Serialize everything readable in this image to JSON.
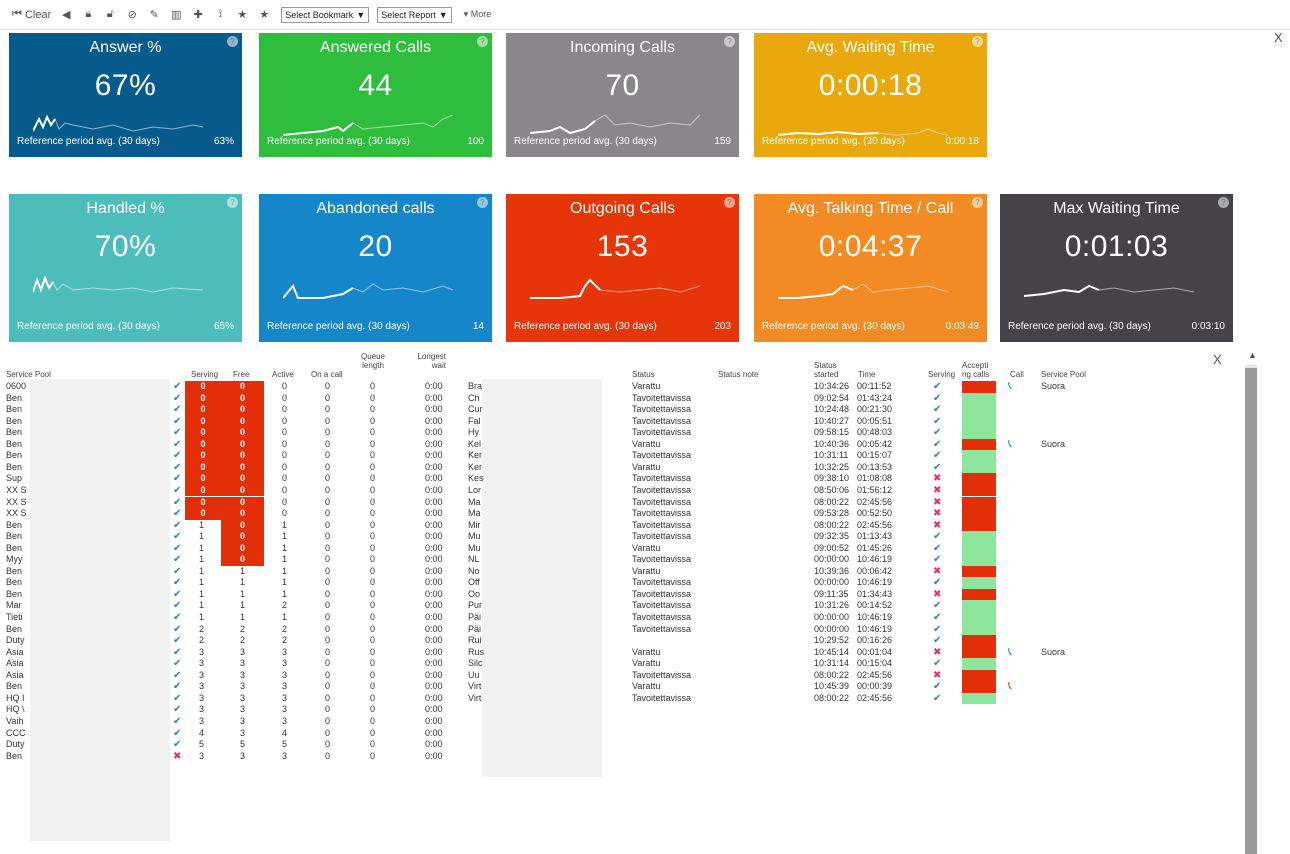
{
  "toolbar": {
    "clear_label": "Clear",
    "bookmark_select": "Select Bookmark",
    "report_select": "Select Report",
    "more_label": "More"
  },
  "close_label": "X",
  "help_label": "?",
  "tiles": [
    {
      "title": "Answer %",
      "value": "67%",
      "ref_label": "Reference period avg. (30 days)",
      "ref_value": "63%",
      "color": "#075b8c"
    },
    {
      "title": "Answered Calls",
      "value": "44",
      "ref_label": "Reference period avg. (30 days)",
      "ref_value": "100",
      "color": "#2fbd3d"
    },
    {
      "title": "Incoming Calls",
      "value": "70",
      "ref_label": "Reference period avg. (30 days)",
      "ref_value": "159",
      "color": "#8a878a"
    },
    {
      "title": "Avg. Waiting Time",
      "value": "0:00:18",
      "ref_label": "Reference period avg. (30 days)",
      "ref_value": "0:00:18",
      "color": "#e9a80c"
    },
    {
      "title": "Handled %",
      "value": "70%",
      "ref_label": "Reference period avg. (30 days)",
      "ref_value": "65%",
      "color": "#4cbdbb"
    },
    {
      "title": "Abandoned calls",
      "value": "20",
      "ref_label": "Reference period avg. (30 days)",
      "ref_value": "14",
      "color": "#1486c9"
    },
    {
      "title": "Outgoing Calls",
      "value": "153",
      "ref_label": "Reference period avg. (30 days)",
      "ref_value": "203",
      "color": "#e63508"
    },
    {
      "title": "Avg. Talking Time / Call",
      "value": "0:04:37",
      "ref_label": "Reference period avg. (30 days)",
      "ref_value": "0:03:49",
      "color": "#f28b23"
    },
    {
      "title": "Max Waiting Time",
      "value": "0:01:03",
      "ref_label": "Reference period avg. (30 days)",
      "ref_value": "0:03:10",
      "color": "#454347"
    }
  ],
  "pools": {
    "headers": {
      "pool": "Service Pool",
      "serving": "Serving",
      "free": "Free",
      "active": "Active",
      "on_call": "On a call",
      "queue": "Queue length",
      "wait": "Longest wait"
    },
    "rows": [
      {
        "name": "0600",
        "mark": "check",
        "serving": "0",
        "free": "0",
        "active": "0",
        "on_call": "0",
        "queue": "0",
        "wait": "0:00",
        "red_s": true,
        "red_f": true
      },
      {
        "name": "Ben",
        "mark": "check",
        "serving": "0",
        "free": "0",
        "active": "0",
        "on_call": "0",
        "queue": "0",
        "wait": "0:00",
        "red_s": true,
        "red_f": true
      },
      {
        "name": "Ben",
        "mark": "check",
        "serving": "0",
        "free": "0",
        "active": "0",
        "on_call": "0",
        "queue": "0",
        "wait": "0:00",
        "red_s": true,
        "red_f": true
      },
      {
        "name": "Ben",
        "mark": "check",
        "serving": "0",
        "free": "0",
        "active": "0",
        "on_call": "0",
        "queue": "0",
        "wait": "0:00",
        "red_s": true,
        "red_f": true
      },
      {
        "name": "Ben",
        "mark": "check",
        "serving": "0",
        "free": "0",
        "active": "0",
        "on_call": "0",
        "queue": "0",
        "wait": "0:00",
        "red_s": true,
        "red_f": true
      },
      {
        "name": "Ben",
        "mark": "check",
        "serving": "0",
        "free": "0",
        "active": "0",
        "on_call": "0",
        "queue": "0",
        "wait": "0:00",
        "red_s": true,
        "red_f": true
      },
      {
        "name": "Ben",
        "mark": "check",
        "serving": "0",
        "free": "0",
        "active": "0",
        "on_call": "0",
        "queue": "0",
        "wait": "0:00",
        "red_s": true,
        "red_f": true
      },
      {
        "name": "Ben",
        "mark": "check",
        "serving": "0",
        "free": "0",
        "active": "0",
        "on_call": "0",
        "queue": "0",
        "wait": "0:00",
        "red_s": true,
        "red_f": true
      },
      {
        "name": "Sup",
        "mark": "check",
        "serving": "0",
        "free": "0",
        "active": "0",
        "on_call": "0",
        "queue": "0",
        "wait": "0:00",
        "red_s": true,
        "red_f": true
      },
      {
        "name": "XX S",
        "mark": "check",
        "serving": "0",
        "free": "0",
        "active": "0",
        "on_call": "0",
        "queue": "0",
        "wait": "0:00",
        "red_s": true,
        "red_f": true
      },
      {
        "name": "XX S",
        "mark": "check",
        "serving": "0",
        "free": "0",
        "active": "0",
        "on_call": "0",
        "queue": "0",
        "wait": "0:00",
        "red_s": true,
        "red_f": true
      },
      {
        "name": "XX S",
        "mark": "check",
        "serving": "0",
        "free": "0",
        "active": "0",
        "on_call": "0",
        "queue": "0",
        "wait": "0:00",
        "red_s": true,
        "red_f": true
      },
      {
        "name": "Ben",
        "mark": "check",
        "serving": "1",
        "free": "0",
        "active": "1",
        "on_call": "0",
        "queue": "0",
        "wait": "0:00",
        "red_s": false,
        "red_f": true
      },
      {
        "name": "Ben",
        "mark": "check",
        "serving": "1",
        "free": "0",
        "active": "1",
        "on_call": "0",
        "queue": "0",
        "wait": "0:00",
        "red_s": false,
        "red_f": true
      },
      {
        "name": "Ben",
        "mark": "check",
        "serving": "1",
        "free": "0",
        "active": "1",
        "on_call": "0",
        "queue": "0",
        "wait": "0:00",
        "red_s": false,
        "red_f": true
      },
      {
        "name": "Myy",
        "mark": "check",
        "serving": "1",
        "free": "0",
        "active": "1",
        "on_call": "0",
        "queue": "0",
        "wait": "0:00",
        "red_s": false,
        "red_f": true
      },
      {
        "name": "Ben",
        "mark": "check",
        "serving": "1",
        "free": "1",
        "active": "1",
        "on_call": "0",
        "queue": "0",
        "wait": "0:00",
        "red_s": false,
        "red_f": false
      },
      {
        "name": "Ben",
        "mark": "check",
        "serving": "1",
        "free": "1",
        "active": "1",
        "on_call": "0",
        "queue": "0",
        "wait": "0:00",
        "red_s": false,
        "red_f": false
      },
      {
        "name": "Ben",
        "mark": "check",
        "serving": "1",
        "free": "1",
        "active": "1",
        "on_call": "0",
        "queue": "0",
        "wait": "0:00",
        "red_s": false,
        "red_f": false
      },
      {
        "name": "Mar",
        "mark": "check",
        "serving": "1",
        "free": "1",
        "active": "2",
        "on_call": "0",
        "queue": "0",
        "wait": "0:00",
        "red_s": false,
        "red_f": false
      },
      {
        "name": "Tieti",
        "mark": "check",
        "serving": "1",
        "free": "1",
        "active": "1",
        "on_call": "0",
        "queue": "0",
        "wait": "0:00",
        "red_s": false,
        "red_f": false
      },
      {
        "name": "Ben",
        "mark": "check",
        "serving": "2",
        "free": "2",
        "active": "2",
        "on_call": "0",
        "queue": "0",
        "wait": "0:00",
        "red_s": false,
        "red_f": false
      },
      {
        "name": "Duty",
        "mark": "check",
        "serving": "2",
        "free": "2",
        "active": "2",
        "on_call": "0",
        "queue": "0",
        "wait": "0:00",
        "red_s": false,
        "red_f": false
      },
      {
        "name": "Asia",
        "mark": "check",
        "serving": "3",
        "free": "3",
        "active": "3",
        "on_call": "0",
        "queue": "0",
        "wait": "0:00",
        "red_s": false,
        "red_f": false
      },
      {
        "name": "Asia",
        "mark": "check",
        "serving": "3",
        "free": "3",
        "active": "3",
        "on_call": "0",
        "queue": "0",
        "wait": "0:00",
        "red_s": false,
        "red_f": false
      },
      {
        "name": "Asia",
        "mark": "check",
        "serving": "3",
        "free": "3",
        "active": "3",
        "on_call": "0",
        "queue": "0",
        "wait": "0:00",
        "red_s": false,
        "red_f": false
      },
      {
        "name": "Ben",
        "mark": "check",
        "serving": "3",
        "free": "3",
        "active": "3",
        "on_call": "0",
        "queue": "0",
        "wait": "0:00",
        "red_s": false,
        "red_f": false
      },
      {
        "name": "HQ I",
        "mark": "check",
        "serving": "3",
        "free": "3",
        "active": "3",
        "on_call": "0",
        "queue": "0",
        "wait": "0:00",
        "red_s": false,
        "red_f": false
      },
      {
        "name": "HQ \\",
        "mark": "check",
        "serving": "3",
        "free": "3",
        "active": "3",
        "on_call": "0",
        "queue": "0",
        "wait": "0:00",
        "red_s": false,
        "red_f": false
      },
      {
        "name": "Vaih",
        "mark": "check",
        "serving": "3",
        "free": "3",
        "active": "3",
        "on_call": "0",
        "queue": "0",
        "wait": "0:00",
        "red_s": false,
        "red_f": false
      },
      {
        "name": "CCC",
        "mark": "check",
        "serving": "4",
        "free": "3",
        "active": "4",
        "on_call": "0",
        "queue": "0",
        "wait": "0:00",
        "red_s": false,
        "red_f": false
      },
      {
        "name": "Duty",
        "mark": "check",
        "serving": "5",
        "free": "5",
        "active": "5",
        "on_call": "0",
        "queue": "0",
        "wait": "0:00",
        "red_s": false,
        "red_f": false
      },
      {
        "name": "Ben",
        "mark": "cross",
        "serving": "3",
        "free": "3",
        "active": "3",
        "on_call": "0",
        "queue": "0",
        "wait": "0:00",
        "red_s": false,
        "red_f": false
      }
    ]
  },
  "agents": {
    "headers": {
      "status": "Status",
      "note": "Status note",
      "started_1": "Status",
      "started_2": "started",
      "time": "Time",
      "serving": "Serving",
      "accepting_1": "Accepti",
      "accepting_2": "ng calls",
      "call": "Call",
      "pool": "Service Pool"
    },
    "rows": [
      {
        "name": "Bra",
        "status": "Varattu",
        "started": "10:34:26",
        "time": "00:11:52",
        "serving": "check",
        "accept": "red",
        "call": "blue",
        "pool": "Suora"
      },
      {
        "name": "Ch",
        "status": "Tavoitettavissa",
        "started": "09:02:54",
        "time": "01:43:24",
        "serving": "check",
        "accept": "green",
        "call": "",
        "pool": ""
      },
      {
        "name": "Cur",
        "status": "Tavoitettavissa",
        "started": "10:24:48",
        "time": "00:21:30",
        "serving": "check",
        "accept": "green",
        "call": "",
        "pool": ""
      },
      {
        "name": "Fal",
        "status": "Tavoitettavissa",
        "started": "10:40:27",
        "time": "00:05:51",
        "serving": "check",
        "accept": "green",
        "call": "",
        "pool": ""
      },
      {
        "name": "Hy",
        "status": "Tavoitettavissa",
        "started": "09:58:15",
        "time": "00:48:03",
        "serving": "check",
        "accept": "green",
        "call": "",
        "pool": ""
      },
      {
        "name": "Kel",
        "status": "Varattu",
        "started": "10:40:36",
        "time": "00:05:42",
        "serving": "check",
        "accept": "red",
        "call": "blue",
        "pool": "Suora"
      },
      {
        "name": "Ker",
        "status": "Tavoitettavissa",
        "started": "10:31:11",
        "time": "00:15:07",
        "serving": "check",
        "accept": "green",
        "call": "",
        "pool": ""
      },
      {
        "name": "Ker",
        "status": "Varattu",
        "started": "10:32:25",
        "time": "00:13:53",
        "serving": "check",
        "accept": "green",
        "call": "",
        "pool": ""
      },
      {
        "name": "Kes",
        "status": "Tavoitettavissa",
        "started": "09:38:10",
        "time": "01:08:08",
        "serving": "cross",
        "accept": "red",
        "call": "",
        "pool": ""
      },
      {
        "name": "Lor",
        "status": "Tavoitettavissa",
        "started": "08:50:06",
        "time": "01:56:12",
        "serving": "cross",
        "accept": "red",
        "call": "",
        "pool": ""
      },
      {
        "name": "Ma",
        "status": "Tavoitettavissa",
        "started": "08:00:22",
        "time": "02:45:56",
        "serving": "cross",
        "accept": "red",
        "call": "",
        "pool": ""
      },
      {
        "name": "Ma",
        "status": "Tavoitettavissa",
        "started": "09:53:28",
        "time": "00:52:50",
        "serving": "cross",
        "accept": "red",
        "call": "",
        "pool": ""
      },
      {
        "name": "Mir",
        "status": "Tavoitettavissa",
        "started": "08:00:22",
        "time": "02:45:56",
        "serving": "cross",
        "accept": "red",
        "call": "",
        "pool": ""
      },
      {
        "name": "Mu",
        "status": "Tavoitettavissa",
        "started": "09:32:35",
        "time": "01:13:43",
        "serving": "check",
        "accept": "green",
        "call": "",
        "pool": ""
      },
      {
        "name": "Mu",
        "status": "Varattu",
        "started": "09:00:52",
        "time": "01:45:26",
        "serving": "check",
        "accept": "green",
        "call": "",
        "pool": ""
      },
      {
        "name": "NL",
        "status": "Tavoitettavissa",
        "started": "00:00:00",
        "time": "10:46:19",
        "serving": "check",
        "accept": "green",
        "call": "",
        "pool": ""
      },
      {
        "name": "No",
        "status": "Varattu",
        "started": "10:39:36",
        "time": "00:06:42",
        "serving": "cross",
        "accept": "red",
        "call": "",
        "pool": ""
      },
      {
        "name": "Off",
        "status": "Tavoitettavissa",
        "started": "00:00:00",
        "time": "10:46:19",
        "serving": "check",
        "accept": "green",
        "call": "",
        "pool": ""
      },
      {
        "name": "Oo",
        "status": "Tavoitettavissa",
        "started": "09:11:35",
        "time": "01:34:43",
        "serving": "cross",
        "accept": "red",
        "call": "",
        "pool": ""
      },
      {
        "name": "Pur",
        "status": "Tavoitettavissa",
        "started": "10:31:26",
        "time": "00:14:52",
        "serving": "check",
        "accept": "green",
        "call": "",
        "pool": ""
      },
      {
        "name": "Päi",
        "status": "Tavoitettavissa",
        "started": "00:00:00",
        "time": "10:46:19",
        "serving": "check",
        "accept": "green",
        "call": "",
        "pool": ""
      },
      {
        "name": "Päi",
        "status": "Tavoitettavissa",
        "started": "00:00:00",
        "time": "10:46:19",
        "serving": "check",
        "accept": "green",
        "call": "",
        "pool": ""
      },
      {
        "name": "Rui",
        "status": "",
        "started": "10:29:52",
        "time": "00:16:26",
        "serving": "check",
        "accept": "red",
        "call": "",
        "pool": ""
      },
      {
        "name": "Rus",
        "status": "Varattu",
        "started": "10:45:14",
        "time": "00:01:04",
        "serving": "cross",
        "accept": "red",
        "call": "blue",
        "pool": "Suora"
      },
      {
        "name": "Silc",
        "status": "Varattu",
        "started": "10:31:14",
        "time": "00:15:04",
        "serving": "check",
        "accept": "green",
        "call": "",
        "pool": ""
      },
      {
        "name": "Uu",
        "status": "Tavoitettavissa",
        "started": "08:00:22",
        "time": "02:45:56",
        "serving": "cross",
        "accept": "red",
        "call": "",
        "pool": ""
      },
      {
        "name": "Virt",
        "status": "Varattu",
        "started": "10:45:39",
        "time": "00:00:39",
        "serving": "check",
        "accept": "red",
        "call": "red",
        "pool": ""
      },
      {
        "name": "Virt",
        "status": "Tavoitettavissa",
        "started": "08:00:22",
        "time": "02:45:56",
        "serving": "check",
        "accept": "green",
        "call": "",
        "pool": ""
      }
    ]
  }
}
